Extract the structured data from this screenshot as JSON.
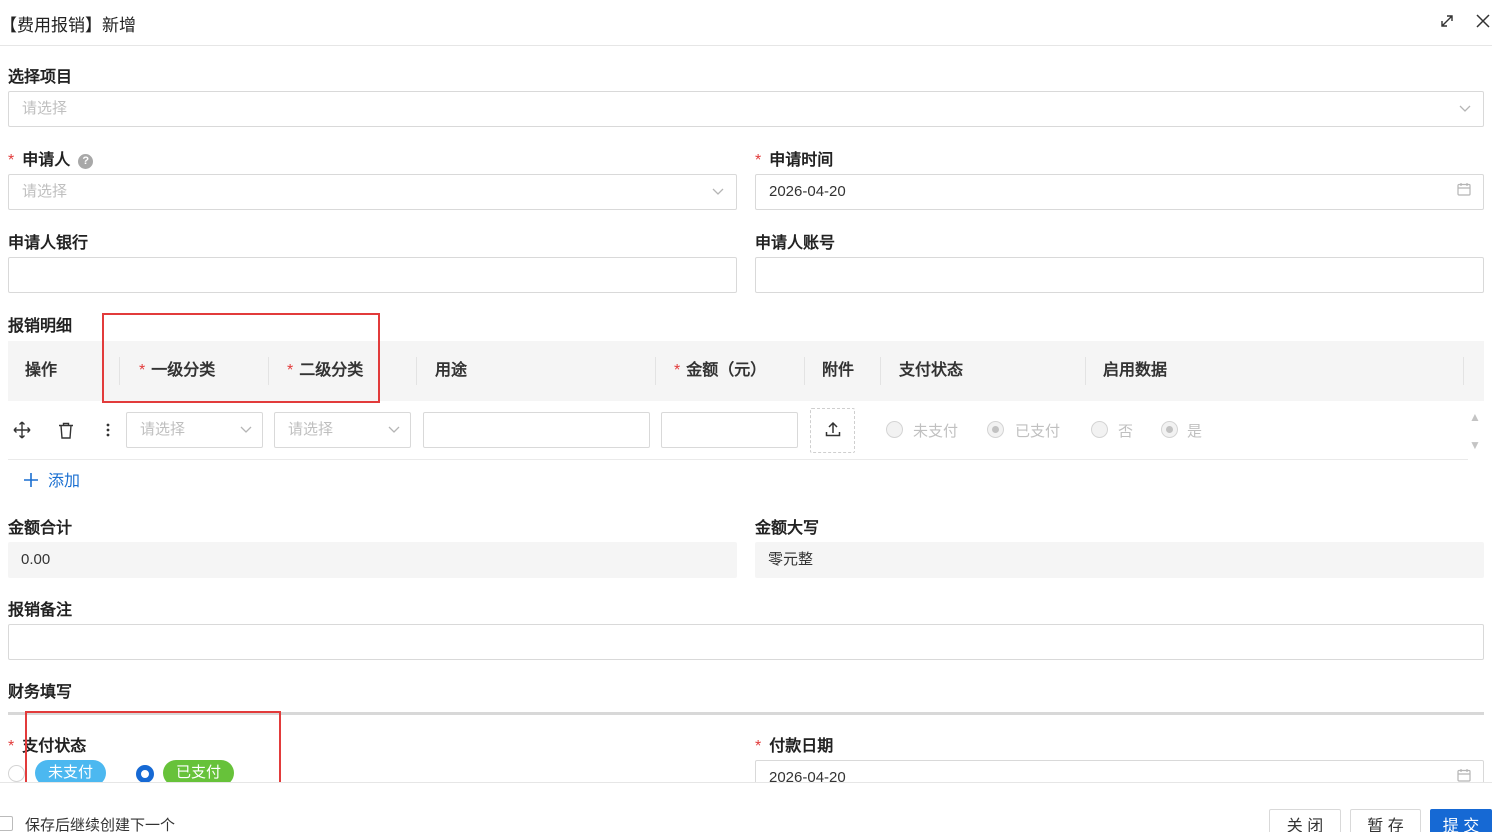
{
  "dialog": {
    "title": "【费用报销】新增"
  },
  "project": {
    "label": "选择项目",
    "placeholder": "请选择"
  },
  "applicant": {
    "label": "申请人",
    "placeholder": "请选择"
  },
  "apply_time": {
    "label": "申请时间",
    "value": "2026-04-20"
  },
  "applicant_bank": {
    "label": "申请人银行",
    "value": ""
  },
  "applicant_account": {
    "label": "申请人账号",
    "value": ""
  },
  "details": {
    "label": "报销明细",
    "columns": [
      "操作",
      "一级分类",
      "二级分类",
      "用途",
      "金额（元）",
      "附件",
      "支付状态",
      "启用数据"
    ],
    "row": {
      "level1_placeholder": "请选择",
      "level2_placeholder": "请选择",
      "pay_status_options": [
        "未支付",
        "已支付"
      ],
      "pay_status_selected": "已支付",
      "enable_options": [
        "否",
        "是"
      ],
      "enable_selected": "是"
    },
    "add_label": "添加"
  },
  "total": {
    "label": "金额合计",
    "value": "0.00"
  },
  "amount_words": {
    "label": "金额大写",
    "value": "零元整"
  },
  "remark": {
    "label": "报销备注",
    "value": ""
  },
  "finance_section": {
    "label": "财务填写"
  },
  "pay_status": {
    "label": "支付状态",
    "options": [
      {
        "label": "未支付",
        "color": "#4cb8f0"
      },
      {
        "label": "已支付",
        "color": "#67c23a"
      }
    ],
    "selected": "已支付"
  },
  "pay_date": {
    "label": "付款日期",
    "value": "2026-04-20"
  },
  "footer": {
    "continue_label": "保存后继续创建下一个",
    "close_label": "关 闭",
    "draft_label": "暂 存",
    "submit_label": "提 交"
  },
  "colors": {
    "primary": "#1669d4",
    "required": "#e23b3b",
    "highlight_box": "#e23b3b"
  }
}
